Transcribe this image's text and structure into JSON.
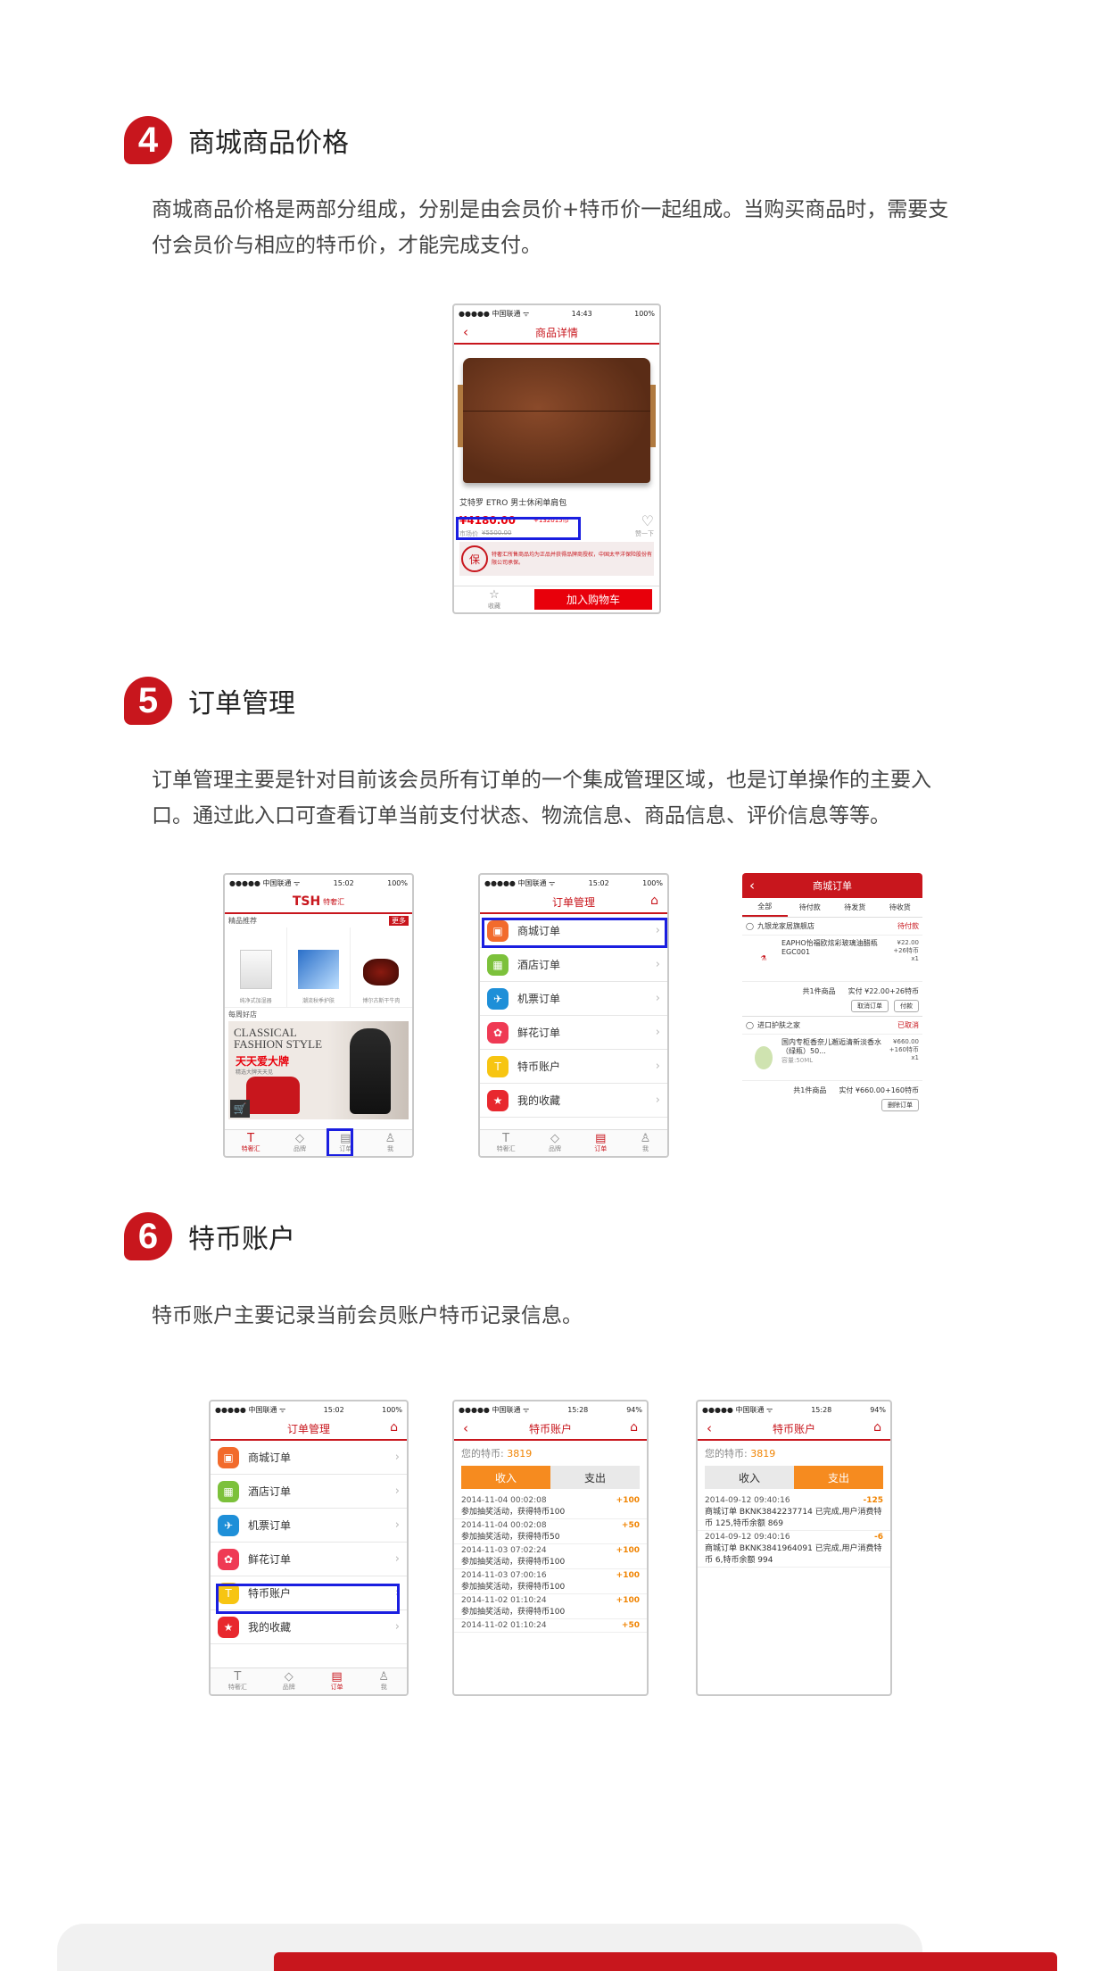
{
  "s4": {
    "num": "4",
    "title": "商城商品价格",
    "desc": "商城商品价格是两部分组成，分别是由会员价+特币价一起组成。当购买商品时，需要支付会员价与相应的特币价，才能完成支付。"
  },
  "s5": {
    "num": "5",
    "title": "订单管理",
    "desc": "订单管理主要是针对目前该会员所有订单的一个集成管理区域，也是订单操作的主要入口。通过此入口可查看订单当前支付状态、物流信息、商品信息、评价信息等等。"
  },
  "s6": {
    "num": "6",
    "title": "特币账户",
    "desc": "特币账户主要记录当前会员账户特币记录信息。"
  },
  "status": {
    "carrier": "●●●●● 中国联通 ᯤ",
    "battery": "100%",
    "battery94": "94%",
    "t1": "14:43",
    "t2": "15:02",
    "t3": "15:28"
  },
  "p1": {
    "title": "商品详情",
    "name": "艾特罗 ETRO 男士休闲单肩包",
    "price": "¥4180.00",
    "coin": "+132015币",
    "old_label": "市场价",
    "old": "¥5500.00",
    "like": "赞一下",
    "notice": "特奢汇所售商品均为正品并获得品牌商授权，中国太平洋保险股份有限公司承保。",
    "fav": "收藏",
    "cart": "加入购物车"
  },
  "p2": {
    "logo": "TSH",
    "logo_sub": "特奢汇",
    "ribbon": "更多",
    "rec_title": "精品推荐",
    "items": [
      "纯净式加湿器",
      "潮流秋季护肤",
      "博尔古斯干牛肉"
    ],
    "daily": "每周好店",
    "banner1": "CLASSICAL",
    "banner2": "FASHION STYLE",
    "banner3": "天天爱大牌",
    "banner4": "精选大牌天天见"
  },
  "tabs": [
    "特奢汇",
    "品牌",
    "订单",
    "我"
  ],
  "order_title": "订单管理",
  "order_rows": [
    "商城订单",
    "酒店订单",
    "机票订单",
    "鲜花订单",
    "特币账户",
    "我的收藏"
  ],
  "p4": {
    "title": "商城订单",
    "tabs": [
      "全部",
      "待付款",
      "待发货",
      "待收货"
    ],
    "store1": "九银龙家居旗舰店",
    "status1": "待付款",
    "prod1": "EAPHO怡福欧炫彩玻璃油醋瓶EGC001",
    "price1": "¥22.00",
    "coin1": "+26特币",
    "qty1": "x1",
    "total1": "共1件商品",
    "paid1": "实付 ¥22.00+26特币",
    "btn1a": "取消订单",
    "btn1b": "付款",
    "store2": "进口护肤之家",
    "status2": "已取消",
    "prod2": "国内专柜香奈儿邂逅清新淡香水（绿瓶）50...",
    "spec2": "容量:50ML",
    "price2": "¥660.00",
    "coin2": "+160特币",
    "qty2": "x1",
    "total2": "共1件商品",
    "paid2": "实付 ¥660.00+160特币",
    "btn2": "删除订单"
  },
  "p6": {
    "title": "特币账户",
    "coins_label": "您的特币:",
    "coins": "3819",
    "in": "收入",
    "out": "支出",
    "records": [
      {
        "date": "2014-11-04 00:02:08",
        "amt": "+100",
        "desc": "参加抽奖活动，获得特币100"
      },
      {
        "date": "2014-11-04 00:02:08",
        "amt": "+50",
        "desc": "参加抽奖活动，获得特币50"
      },
      {
        "date": "2014-11-03 07:02:24",
        "amt": "+100",
        "desc": "参加抽奖活动，获得特币100"
      },
      {
        "date": "2014-11-03 07:00:16",
        "amt": "+100",
        "desc": "参加抽奖活动，获得特币100"
      },
      {
        "date": "2014-11-02 01:10:24",
        "amt": "+100",
        "desc": "参加抽奖活动，获得特币100"
      },
      {
        "date": "2014-11-02 01:10:24",
        "amt": "+50",
        "desc": ""
      }
    ]
  },
  "p7": {
    "records": [
      {
        "date": "2014-09-12 09:40:16",
        "amt": "-125",
        "desc": "商城订单 BKNK3842237714 已完成,用户消费特币 125,特币余额 869"
      },
      {
        "date": "2014-09-12 09:40:16",
        "amt": "-6",
        "desc": "商城订单 BKNK3841964091 已完成,用户消费特币 6,特币余额 994"
      }
    ]
  }
}
